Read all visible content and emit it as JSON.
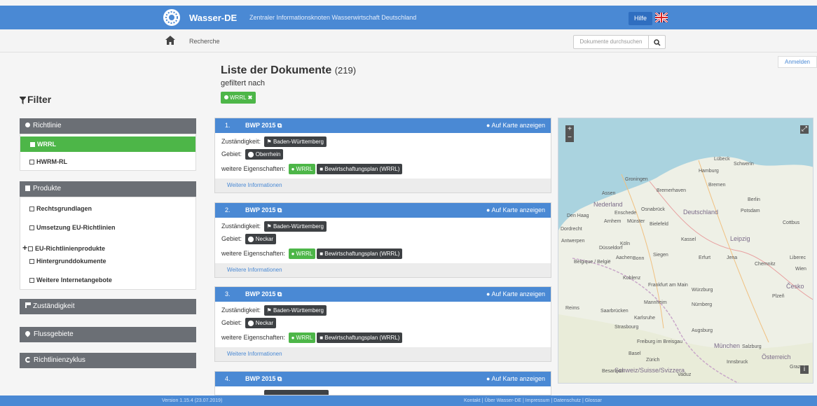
{
  "header": {
    "brand": "Wasser-DE",
    "tagline": "Zentraler Informationsknoten Wasserwirtschaft Deutschland",
    "help_label": "Hilfe"
  },
  "subnav": {
    "breadcrumb": "Recherche",
    "search_placeholder": "Dokumente durchsuchen"
  },
  "login_label": "Anmelden",
  "filter": {
    "title": "Filter",
    "richtlinie": {
      "title": "Richtlinie",
      "items": [
        "WRRL",
        "HWRM-RL"
      ]
    },
    "produkte": {
      "title": "Produkte",
      "items": [
        "Rechtsgrundlagen",
        "Umsetzung EU-Richtlinien",
        "EU-Richtlinienprodukte",
        "Hintergrunddokumente",
        "Weitere Internetangebote"
      ]
    },
    "zustaendigkeit": "Zuständigkeit",
    "flussgebiete": "Flussgebiete",
    "zyklus": "Richtlinienzyklus"
  },
  "list": {
    "title": "Liste der Dokumente",
    "count": "(219)",
    "filtered_by": "gefiltert nach",
    "active_filter": "WRRL",
    "map_label": "Auf Karte anzeigen",
    "more_label": "Weitere Informationen",
    "zust_label": "Zuständigkeit:",
    "gebiet_label": "Gebiet:",
    "props_label": "weitere Eigenschaften:",
    "docs": [
      {
        "num": "1.",
        "title": "BWP 2015",
        "zust": "Baden-Württemberg",
        "gebiet": "Oberrhein",
        "prop1": "WRRL",
        "prop2": "Bewirtschaftungsplan (WRRL)"
      },
      {
        "num": "2.",
        "title": "BWP 2015",
        "zust": "Baden-Württemberg",
        "gebiet": "Neckar",
        "prop1": "WRRL",
        "prop2": "Bewirtschaftungsplan (WRRL)"
      },
      {
        "num": "3.",
        "title": "BWP 2015",
        "zust": "Baden-Württemberg",
        "gebiet": "Neckar",
        "prop1": "WRRL",
        "prop2": "Bewirtschaftungsplan (WRRL)"
      },
      {
        "num": "4.",
        "title": "BWP 2015"
      }
    ]
  },
  "map": {
    "labels": [
      "Hamburg",
      "Bremen",
      "Groningen",
      "Nederland",
      "Deutschland",
      "Berlin",
      "Potsdam",
      "Den Haag",
      "Osnabrück",
      "Münster",
      "Bielefeld",
      "Kassel",
      "Leipzig",
      "Antwerpen",
      "Düsseldorf",
      "Koblenz",
      "Belgique / België",
      "Frankfurt am Main",
      "Würzburg",
      "Nürnberg",
      "Karlsruhe",
      "Strasbourg",
      "Augsburg",
      "München",
      "Freiburg im Breisgau",
      "Schweiz/Suisse/Svizzera",
      "Vaduz",
      "Österreich",
      "Česko",
      "Lübeck",
      "Bremerhaven",
      "Zürich",
      "Basel",
      "Saarbrücken",
      "Mannheim",
      "Reims",
      "Besançon",
      "Innsbruck",
      "Salzburg",
      "Plzeň",
      "Chemnitz",
      "Erfurt",
      "Jena",
      "Siegen",
      "Bonn",
      "Aachen",
      "Cottbus",
      "Liberec",
      "Schwerin",
      "Assen",
      "Enschede",
      "Arnhem",
      "Dordrecht",
      "Köln",
      "Wien",
      "Graz"
    ]
  },
  "footer": {
    "version": "Version 1.15.4 (23.07.2019)",
    "links": "Kontakt | Über Wasser-DE | Impressum | Datenschutz | Glossar"
  },
  "colors": {
    "primary": "#4a89d4",
    "active": "#4db648",
    "panel": "#6b6f75"
  }
}
